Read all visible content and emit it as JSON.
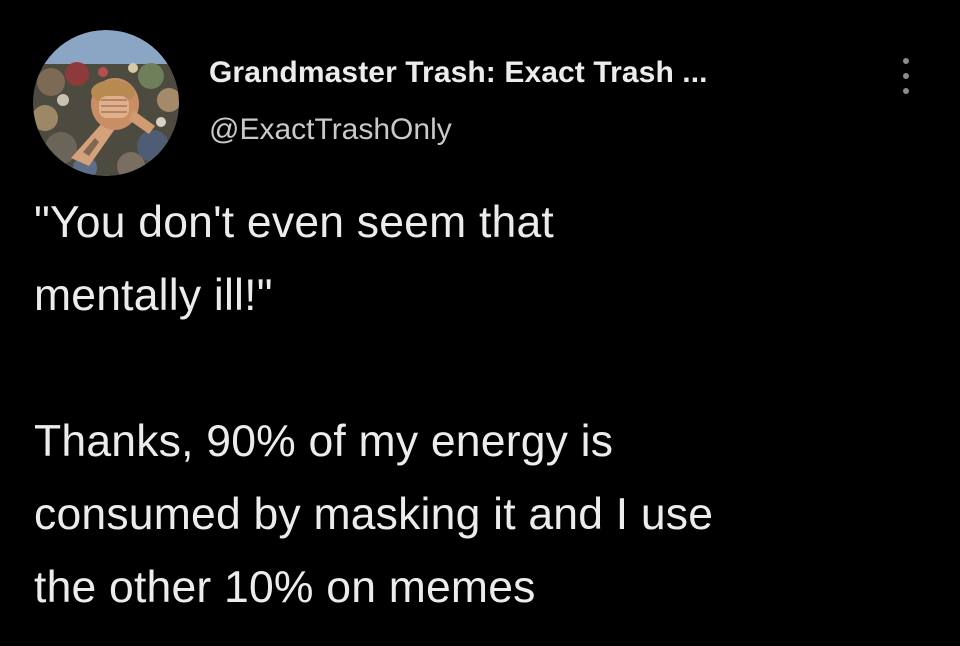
{
  "tweet": {
    "display_name": "Grandmaster Trash: Exact Trash ...",
    "handle": "@ExactTrashOnly",
    "avatar_description_icon": "profile-avatar-photo",
    "more_icon": "vertical-ellipsis-icon",
    "paragraph_1": "\"You don't even seem that\nmentally ill!\"",
    "paragraph_2": "Thanks, 90% of my energy is\nconsumed by masking it and I use\nthe other 10% on memes"
  },
  "colors": {
    "background": "#000000",
    "text": "#ececec",
    "handle": "#c9c9c9",
    "icon": "#8c8c8c"
  }
}
